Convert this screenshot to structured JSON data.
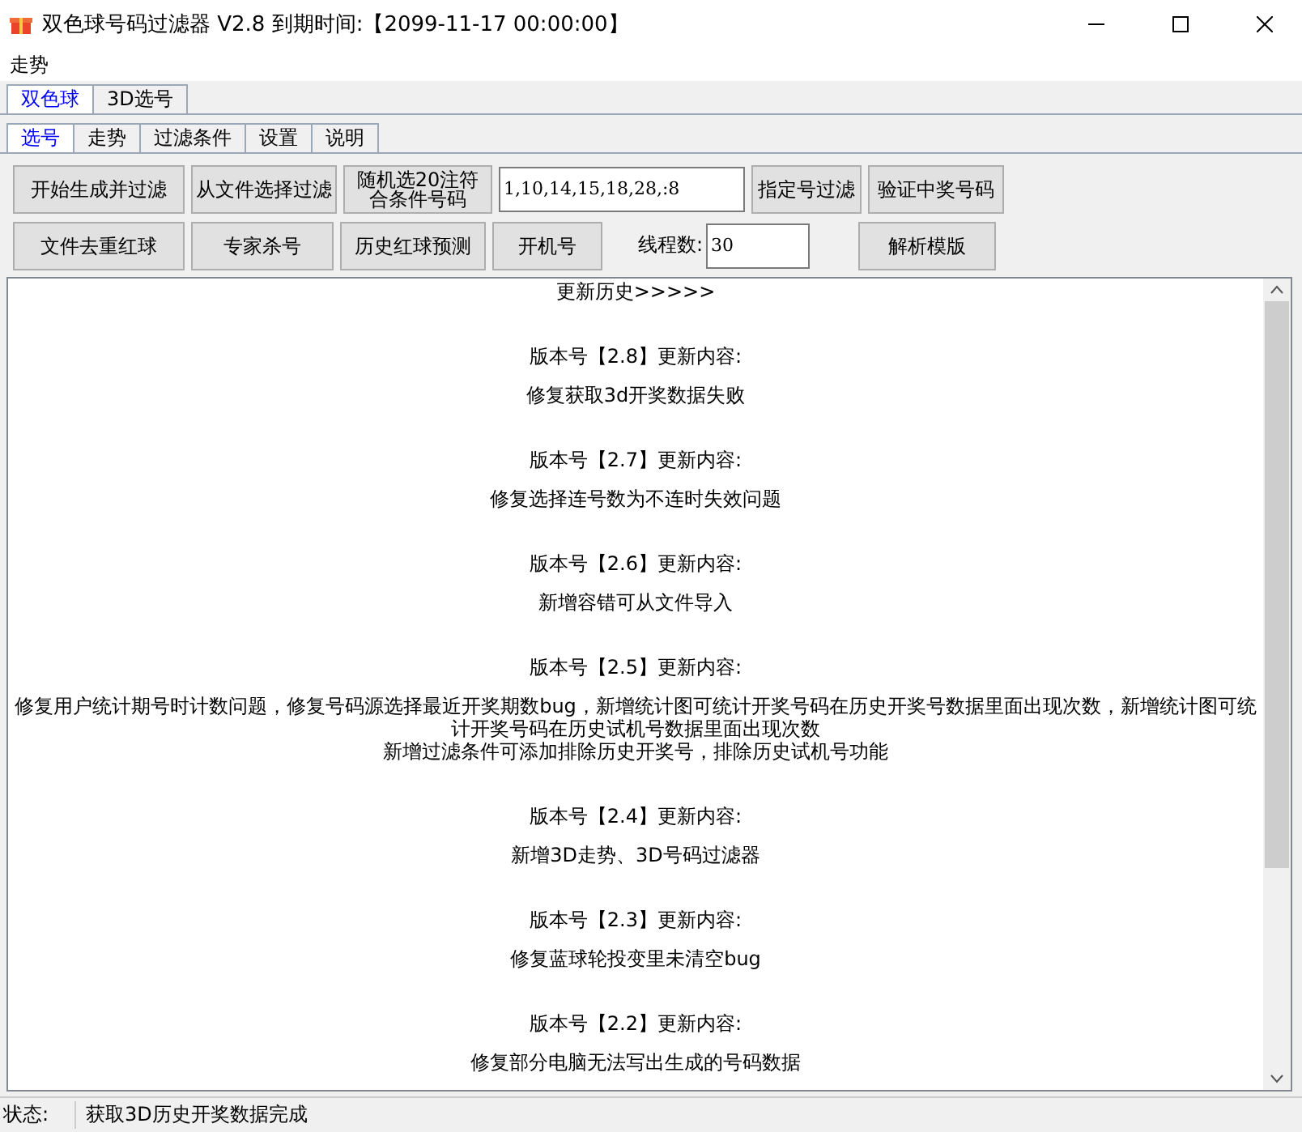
{
  "window": {
    "title": "双色球号码过滤器 V2.8 到期时间:【2099-11-17 00:00:00】"
  },
  "menu": [
    {
      "label": "走势"
    }
  ],
  "tabs": [
    {
      "label": "双色球",
      "selected": true
    },
    {
      "label": "3D选号",
      "selected": false
    }
  ],
  "subtabs": [
    {
      "label": "选号",
      "selected": true
    },
    {
      "label": "走势",
      "selected": false
    },
    {
      "label": "过滤条件",
      "selected": false
    },
    {
      "label": "设置",
      "selected": false
    },
    {
      "label": "说明",
      "selected": false
    }
  ],
  "toolbar_rows": [
    [
      {
        "kind": "button",
        "label": "开始生成并过滤"
      },
      {
        "kind": "button",
        "label": "从文件选择过滤"
      },
      {
        "kind": "button",
        "label": "随机选20注符合条件号码"
      },
      {
        "kind": "input",
        "value": "1,10,14,15,18,28,:8"
      },
      {
        "kind": "button",
        "label": "指定号过滤"
      },
      {
        "kind": "button",
        "label": "验证中奖号码"
      }
    ],
    [
      {
        "kind": "button",
        "label": "文件去重红球"
      },
      {
        "kind": "button",
        "label": "专家杀号"
      },
      {
        "kind": "button",
        "label": "历史红球预测"
      },
      {
        "kind": "button",
        "label": "开机号"
      },
      {
        "kind": "labeled-input",
        "label": "线程数:",
        "value": "30"
      },
      {
        "kind": "button",
        "label": "解析模版"
      }
    ]
  ],
  "history": {
    "heading": "更新历史>>>>>",
    "entries": [
      {
        "version": "版本号【2.8】更新内容:",
        "lines": [
          "修复获取3d开奖数据失败"
        ]
      },
      {
        "version": "版本号【2.7】更新内容:",
        "lines": [
          "修复选择连号数为不连时失效问题"
        ]
      },
      {
        "version": "版本号【2.6】更新内容:",
        "lines": [
          "新增容错可从文件导入"
        ]
      },
      {
        "version": "版本号【2.5】更新内容:",
        "lines": [
          "修复用户统计期号时计数问题，修复号码源选择最近开奖期数bug，新增统计图可统计开奖号码在历史开奖号数据里面出现次数，新增统计图可统计开奖号码在历史试机号数据里面出现次数",
          "新增过滤条件可添加排除历史开奖号，排除历史试机号功能"
        ]
      },
      {
        "version": "版本号【2.4】更新内容:",
        "lines": [
          "新增3D走势、3D号码过滤器"
        ]
      },
      {
        "version": "版本号【2.3】更新内容:",
        "lines": [
          "修复蓝球轮投变里未清空bug"
        ]
      },
      {
        "version": "版本号【2.2】更新内容:",
        "lines": [
          "修复部分电脑无法写出生成的号码数据"
        ]
      }
    ]
  },
  "status_bar": {
    "label": "状态:",
    "value": "获取3D历史开奖数据完成"
  }
}
